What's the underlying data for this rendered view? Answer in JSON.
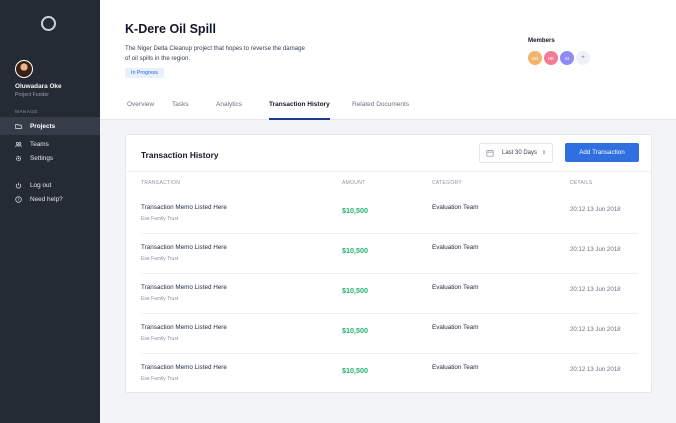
{
  "sidebar": {
    "user": {
      "name": "Oluwadara Oke",
      "role": "Project Funder"
    },
    "section_label": "MANAGE",
    "items": [
      {
        "label": "Projects",
        "icon": "folder-icon",
        "active": true
      },
      {
        "label": "Teams",
        "icon": "users-icon",
        "active": false
      },
      {
        "label": "Settings",
        "icon": "gear-icon",
        "active": false
      },
      {
        "label": "Log out",
        "icon": "power-icon",
        "active": false
      },
      {
        "label": "Need help?",
        "icon": "help-icon",
        "active": false
      }
    ]
  },
  "project": {
    "title": "K-Dere Oil Spill",
    "description": "The Niger Delta Cleanup project that hopes to reverse the damage of oil spills in the region.",
    "status": "In Progress"
  },
  "members": {
    "label": "Members",
    "avatars": [
      {
        "initials": "DO",
        "color": "#f2b36b"
      },
      {
        "initials": "HK",
        "color": "#f47b97"
      },
      {
        "initials": "SI",
        "color": "#8e8cf2"
      }
    ],
    "add_label": "+"
  },
  "tabs": [
    {
      "label": "Overview",
      "active": false
    },
    {
      "label": "Tasks",
      "active": false
    },
    {
      "label": "Analytics",
      "active": false
    },
    {
      "label": "Transaction History",
      "active": true
    },
    {
      "label": "Related Documents",
      "active": false
    }
  ],
  "transactions": {
    "title": "Transaction History",
    "filter": "Last 30 Days",
    "add_button": "Add Transaction",
    "columns": [
      "TRANSACTION",
      "AMOUNT",
      "CATEGORY",
      "DETAILS"
    ],
    "rows": [
      {
        "memo": "Transaction Memo Listed Here",
        "source": "Ese Family Trust",
        "amount": "$10,500",
        "category": "Evaluation Team",
        "details": "20:12 13 Jun 2018"
      },
      {
        "memo": "Transaction Memo Listed Here",
        "source": "Ese Family Trust",
        "amount": "$10,500",
        "category": "Evaluation Team",
        "details": "20:12 13 Jun 2018"
      },
      {
        "memo": "Transaction Memo Listed Here",
        "source": "Ese Family Trust",
        "amount": "$10,500",
        "category": "Evaluation Team",
        "details": "20:12 13 Jun 2018"
      },
      {
        "memo": "Transaction Memo Listed Here",
        "source": "Ese Family Trust",
        "amount": "$10,500",
        "category": "Evaluation Team",
        "details": "20:12 13 Jun 2018"
      },
      {
        "memo": "Transaction Memo Listed Here",
        "source": "Ese Family Trust",
        "amount": "$10,500",
        "category": "Evaluation Team",
        "details": "20:12 13 Jun 2018"
      }
    ]
  },
  "colors": {
    "sidebar": "#252b34",
    "accent": "#2f6fe0",
    "amount": "#22b26a"
  }
}
